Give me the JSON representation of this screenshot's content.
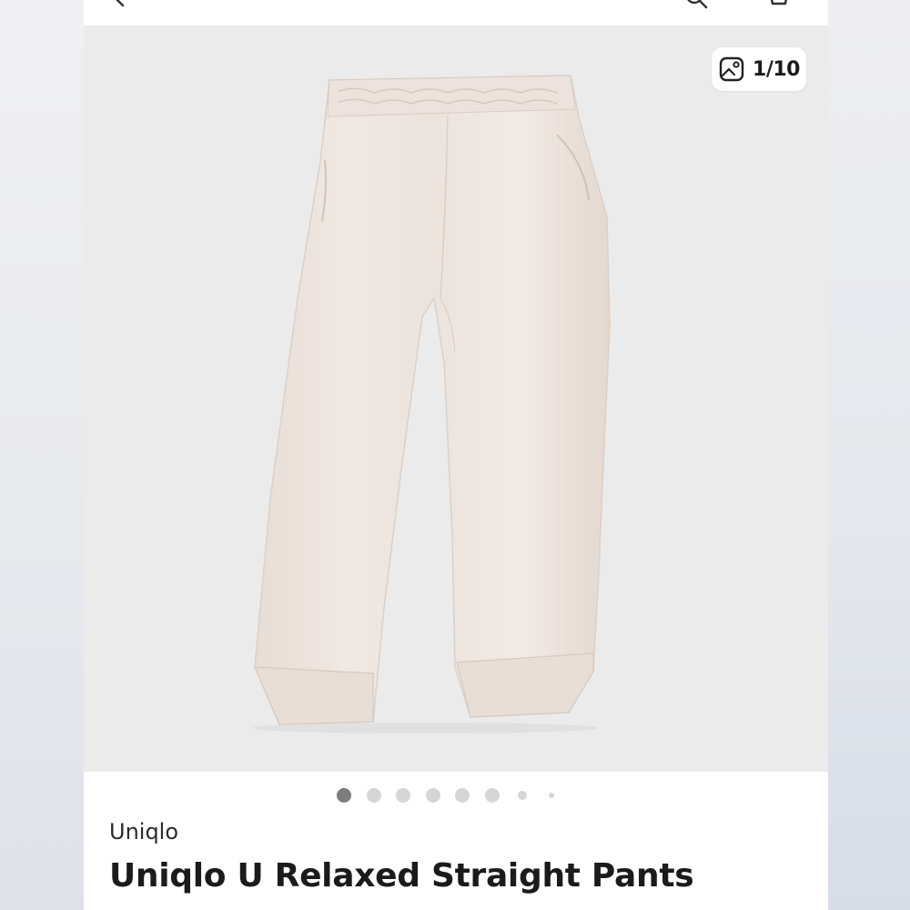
{
  "gallery": {
    "counter": "1/10",
    "image_alt": "Light beige relaxed straight pants",
    "dot_count": 8,
    "active_dot": 0
  },
  "product": {
    "brand": "Uniqlo",
    "title": "Uniqlo U Relaxed Straight Pants"
  },
  "colors": {
    "pants": "#efe6df",
    "gallery_bg": "#ebebeb",
    "dot_active": "#7d7d7d",
    "dot_inactive": "#d6d6d6"
  },
  "icons": [
    "back-icon",
    "search-icon",
    "cart-icon",
    "image-icon"
  ]
}
